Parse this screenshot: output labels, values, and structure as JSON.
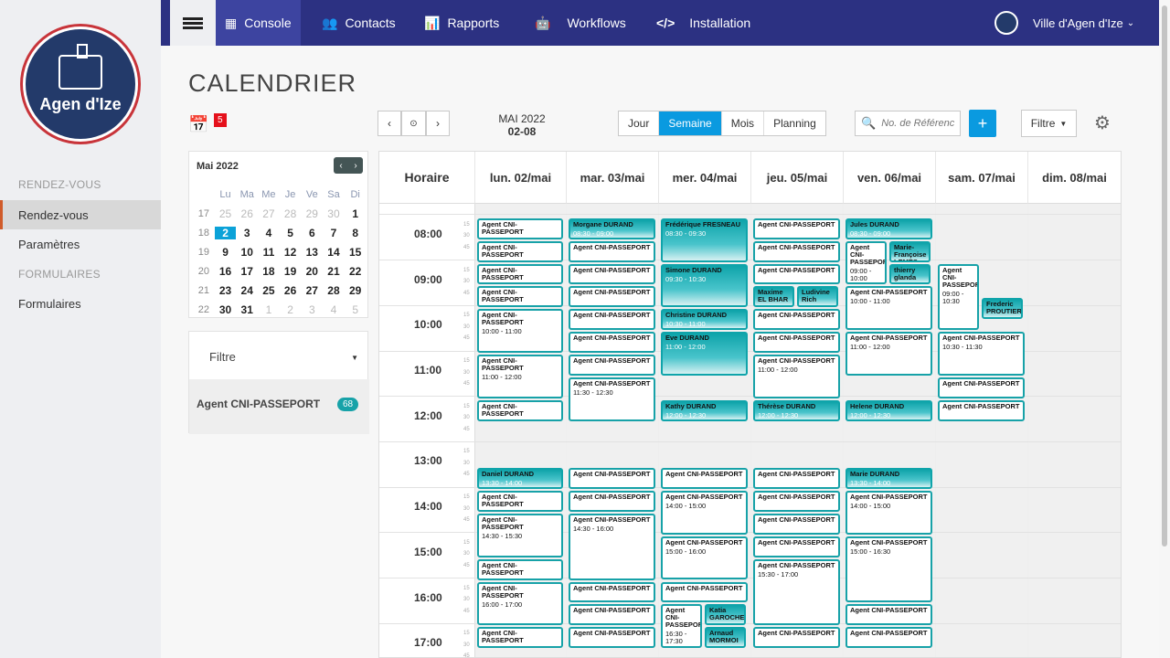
{
  "nav": {
    "items": [
      {
        "label": "Console",
        "icon": "grid-icon",
        "active": true
      },
      {
        "label": "Contacts",
        "icon": "users-icon",
        "active": false
      },
      {
        "label": "Rapports",
        "icon": "bar-chart-icon",
        "active": false
      },
      {
        "label": "Workflows",
        "icon": "robot-icon",
        "active": false
      },
      {
        "label": "Installation",
        "icon": "code-icon",
        "active": false
      }
    ],
    "org": "Ville d'Agen d'Ize"
  },
  "logo": {
    "text": "Agen d'Ize"
  },
  "sidebar": {
    "section1": "RENDEZ-VOUS",
    "items1": [
      "Rendez-vous",
      "Paramètres"
    ],
    "section2": "FORMULAIRES",
    "items2": [
      "Formulaires"
    ]
  },
  "page": {
    "title": "CALENDRIER",
    "badge": "5"
  },
  "minical": {
    "month": "Mai 2022",
    "headers": [
      "Lu",
      "Ma",
      "Me",
      "Je",
      "Ve",
      "Sa",
      "Di"
    ],
    "weeks": [
      {
        "wk": "17",
        "days": [
          "25",
          "26",
          "27",
          "28",
          "29",
          "30",
          "1"
        ],
        "dim": [
          0,
          1,
          2,
          3,
          4,
          5
        ]
      },
      {
        "wk": "18",
        "days": [
          "2",
          "3",
          "4",
          "5",
          "6",
          "7",
          "8"
        ],
        "today": 0
      },
      {
        "wk": "19",
        "days": [
          "9",
          "10",
          "11",
          "12",
          "13",
          "14",
          "15"
        ]
      },
      {
        "wk": "20",
        "days": [
          "16",
          "17",
          "18",
          "19",
          "20",
          "21",
          "22"
        ]
      },
      {
        "wk": "21",
        "days": [
          "23",
          "24",
          "25",
          "26",
          "27",
          "28",
          "29"
        ]
      },
      {
        "wk": "22",
        "days": [
          "30",
          "31",
          "1",
          "2",
          "3",
          "4",
          "5"
        ],
        "dim": [
          2,
          3,
          4,
          5,
          6
        ]
      }
    ]
  },
  "filter": {
    "label": "Filtre",
    "agent": "Agent CNI-PASSEPORT",
    "count": "68"
  },
  "toolbar": {
    "month": "MAI 2022",
    "week": "02-08",
    "views": [
      "Jour",
      "Semaine",
      "Mois",
      "Planning"
    ],
    "active_view": "Semaine",
    "search_placeholder": "No. de Référence",
    "add": "+",
    "filtre": "Filtre"
  },
  "calendar": {
    "horaire": "Horaire",
    "days": [
      "lun. 02/mai",
      "mar. 03/mai",
      "mer. 04/mai",
      "jeu. 05/mai",
      "ven. 06/mai",
      "sam. 07/mai",
      "dim. 08/mai"
    ],
    "hours": [
      "08:00",
      "09:00",
      "10:00",
      "11:00",
      "12:00",
      "13:00",
      "14:00",
      "15:00",
      "16:00",
      "17:00"
    ],
    "subticks": [
      "15",
      "30",
      "45"
    ],
    "events": [
      {
        "d": 0,
        "s": 8.0,
        "e": 8.5,
        "t": "Agent CNI-PASSEPORT",
        "tm": ""
      },
      {
        "d": 0,
        "s": 8.5,
        "e": 9.0,
        "t": "Agent CNI-PASSEPORT",
        "tm": ""
      },
      {
        "d": 0,
        "s": 9.0,
        "e": 9.5,
        "t": "Agent CNI-PASSEPORT",
        "tm": ""
      },
      {
        "d": 0,
        "s": 9.5,
        "e": 10.0,
        "t": "Agent CNI-PASSEPORT",
        "tm": ""
      },
      {
        "d": 0,
        "s": 10.0,
        "e": 11.0,
        "t": "Agent CNI-PASSEPORT",
        "tm": "10:00 - 11:00"
      },
      {
        "d": 0,
        "s": 11.0,
        "e": 12.0,
        "t": "Agent CNI-PASSEPORT",
        "tm": "11:00 - 12:00"
      },
      {
        "d": 0,
        "s": 12.0,
        "e": 12.5,
        "t": "Agent CNI-PASSEPORT",
        "tm": ""
      },
      {
        "d": 0,
        "s": 13.5,
        "e": 14.0,
        "t": "Daniel DURAND",
        "tm": "13:30 - 14:00",
        "fill": true
      },
      {
        "d": 0,
        "s": 14.0,
        "e": 14.5,
        "t": "Agent CNI-PASSEPORT",
        "tm": ""
      },
      {
        "d": 0,
        "s": 14.5,
        "e": 15.5,
        "t": "Agent CNI-PASSEPORT",
        "tm": "14:30 - 15:30"
      },
      {
        "d": 0,
        "s": 15.5,
        "e": 16.0,
        "t": "Agent CNI-PASSEPORT",
        "tm": ""
      },
      {
        "d": 0,
        "s": 16.0,
        "e": 17.0,
        "t": "Agent CNI-PASSEPORT",
        "tm": "16:00 - 17:00"
      },
      {
        "d": 0,
        "s": 17.0,
        "e": 17.5,
        "t": "Agent CNI-PASSEPORT",
        "tm": ""
      },
      {
        "d": 1,
        "s": 8.0,
        "e": 8.5,
        "t": "Morgane DURAND",
        "tm": "08:30 - 09:00",
        "fill": true
      },
      {
        "d": 1,
        "s": 8.5,
        "e": 9.0,
        "t": "Agent CNI-PASSEPORT",
        "tm": ""
      },
      {
        "d": 1,
        "s": 9.0,
        "e": 9.5,
        "t": "Agent CNI-PASSEPORT",
        "tm": ""
      },
      {
        "d": 1,
        "s": 9.5,
        "e": 10.0,
        "t": "Agent CNI-PASSEPORT",
        "tm": ""
      },
      {
        "d": 1,
        "s": 10.0,
        "e": 10.5,
        "t": "Agent CNI-PASSEPORT",
        "tm": ""
      },
      {
        "d": 1,
        "s": 10.5,
        "e": 11.0,
        "t": "Agent CNI-PASSEPORT",
        "tm": ""
      },
      {
        "d": 1,
        "s": 11.0,
        "e": 11.5,
        "t": "Agent CNI-PASSEPORT",
        "tm": ""
      },
      {
        "d": 1,
        "s": 11.5,
        "e": 12.5,
        "t": "Agent CNI-PASSEPORT",
        "tm": "11:30 - 12:30"
      },
      {
        "d": 1,
        "s": 13.5,
        "e": 14.0,
        "t": "Agent CNI-PASSEPORT",
        "tm": ""
      },
      {
        "d": 1,
        "s": 14.0,
        "e": 14.5,
        "t": "Agent CNI-PASSEPORT",
        "tm": ""
      },
      {
        "d": 1,
        "s": 14.5,
        "e": 16.0,
        "t": "Agent CNI-PASSEPORT",
        "tm": "14:30 - 16:00"
      },
      {
        "d": 1,
        "s": 16.0,
        "e": 16.5,
        "t": "Agent CNI-PASSEPORT",
        "tm": ""
      },
      {
        "d": 1,
        "s": 16.5,
        "e": 17.0,
        "t": "Agent CNI-PASSEPORT",
        "tm": ""
      },
      {
        "d": 1,
        "s": 17.0,
        "e": 17.5,
        "t": "Agent CNI-PASSEPORT",
        "tm": ""
      },
      {
        "d": 2,
        "s": 8.0,
        "e": 9.0,
        "t": "Frédérique FRESNEAU",
        "tm": "08:30 - 09:30",
        "fill": true
      },
      {
        "d": 2,
        "s": 9.0,
        "e": 10.0,
        "t": "Simone DURAND",
        "tm": "09:30 - 10:30",
        "fill": true
      },
      {
        "d": 2,
        "s": 10.0,
        "e": 10.5,
        "t": "Christine DURAND",
        "tm": "10:30 - 11:00",
        "fill": true
      },
      {
        "d": 2,
        "s": 10.5,
        "e": 11.5,
        "t": "Eve DURAND",
        "tm": "11:00 - 12:00",
        "fill": true
      },
      {
        "d": 2,
        "s": 12.0,
        "e": 12.5,
        "t": "Kathy DURAND",
        "tm": "12:00 - 12:30",
        "fill": true
      },
      {
        "d": 2,
        "s": 13.5,
        "e": 14.0,
        "t": "Agent CNI-PASSEPORT",
        "tm": ""
      },
      {
        "d": 2,
        "s": 14.0,
        "e": 15.0,
        "t": "Agent CNI-PASSEPORT",
        "tm": "14:00 - 15:00"
      },
      {
        "d": 2,
        "s": 15.0,
        "e": 16.0,
        "t": "Agent CNI-PASSEPORT",
        "tm": "15:00 - 16:00"
      },
      {
        "d": 2,
        "s": 16.0,
        "e": 16.5,
        "t": "Agent CNI-PASSEPORT",
        "tm": ""
      },
      {
        "d": 2,
        "s": 16.5,
        "e": 17.5,
        "t": "Agent CNI-PASSEPORT",
        "tm": "16:30 - 17:30",
        "half": 0
      },
      {
        "d": 2,
        "s": 16.5,
        "e": 17.0,
        "t": "Katia GAROCHE",
        "tm": "",
        "fill": true,
        "half": 1
      },
      {
        "d": 2,
        "s": 17.0,
        "e": 17.5,
        "t": "Arnaud MORMOI",
        "tm": "",
        "fill": true,
        "half": 1
      },
      {
        "d": 3,
        "s": 8.0,
        "e": 8.5,
        "t": "Agent CNI-PASSEPORT",
        "tm": ""
      },
      {
        "d": 3,
        "s": 8.5,
        "e": 9.0,
        "t": "Agent CNI-PASSEPORT",
        "tm": ""
      },
      {
        "d": 3,
        "s": 9.0,
        "e": 9.5,
        "t": "Agent CNI-PASSEPORT",
        "tm": ""
      },
      {
        "d": 3,
        "s": 9.5,
        "e": 10.0,
        "t": "Maxime EL BHAR",
        "tm": "",
        "fill": true,
        "half": 0
      },
      {
        "d": 3,
        "s": 9.5,
        "e": 10.0,
        "t": "Ludivine Rich",
        "tm": "",
        "fill": true,
        "half": 1
      },
      {
        "d": 3,
        "s": 10.0,
        "e": 10.5,
        "t": "Agent CNI-PASSEPORT",
        "tm": ""
      },
      {
        "d": 3,
        "s": 10.5,
        "e": 11.0,
        "t": "Agent CNI-PASSEPORT",
        "tm": ""
      },
      {
        "d": 3,
        "s": 11.0,
        "e": 12.0,
        "t": "Agent CNI-PASSEPORT",
        "tm": "11:00 - 12:00"
      },
      {
        "d": 3,
        "s": 12.0,
        "e": 12.5,
        "t": "Thérèse DURAND",
        "tm": "12:00 - 12:30",
        "fill": true
      },
      {
        "d": 3,
        "s": 13.5,
        "e": 14.0,
        "t": "Agent CNI-PASSEPORT",
        "tm": ""
      },
      {
        "d": 3,
        "s": 14.0,
        "e": 14.5,
        "t": "Agent CNI-PASSEPORT",
        "tm": ""
      },
      {
        "d": 3,
        "s": 14.5,
        "e": 15.0,
        "t": "Agent CNI-PASSEPORT",
        "tm": ""
      },
      {
        "d": 3,
        "s": 15.0,
        "e": 15.5,
        "t": "Agent CNI-PASSEPORT",
        "tm": ""
      },
      {
        "d": 3,
        "s": 15.5,
        "e": 17.0,
        "t": "Agent CNI-PASSEPORT",
        "tm": "15:30 - 17:00"
      },
      {
        "d": 3,
        "s": 17.0,
        "e": 17.5,
        "t": "Agent CNI-PASSEPORT",
        "tm": ""
      },
      {
        "d": 4,
        "s": 8.0,
        "e": 8.5,
        "t": "Jules DURAND",
        "tm": "08:30 - 09:00",
        "fill": true
      },
      {
        "d": 4,
        "s": 8.5,
        "e": 9.5,
        "t": "Agent CNI-PASSEPORT",
        "tm": "09:00 - 10:00",
        "half": 0
      },
      {
        "d": 4,
        "s": 8.5,
        "e": 9.0,
        "t": "Marie-Françoise LEMES",
        "tm": "",
        "fill": true,
        "half": 1
      },
      {
        "d": 4,
        "s": 9.0,
        "e": 9.5,
        "t": "thierry glanda",
        "tm": "",
        "fill": true,
        "half": 1
      },
      {
        "d": 4,
        "s": 9.5,
        "e": 10.5,
        "t": "Agent CNI-PASSEPORT",
        "tm": "10:00 - 11:00"
      },
      {
        "d": 4,
        "s": 10.5,
        "e": 11.5,
        "t": "Agent CNI-PASSEPORT",
        "tm": "11:00 - 12:00"
      },
      {
        "d": 4,
        "s": 12.0,
        "e": 12.5,
        "t": "Helene DURAND",
        "tm": "12:00 - 12:30",
        "fill": true
      },
      {
        "d": 4,
        "s": 13.5,
        "e": 14.0,
        "t": "Marie DURAND",
        "tm": "13:30 - 14:00",
        "fill": true
      },
      {
        "d": 4,
        "s": 14.0,
        "e": 15.0,
        "t": "Agent CNI-PASSEPORT",
        "tm": "14:00 - 15:00"
      },
      {
        "d": 4,
        "s": 15.0,
        "e": 16.5,
        "t": "Agent CNI-PASSEPORT",
        "tm": "15:00 - 16:30"
      },
      {
        "d": 4,
        "s": 16.5,
        "e": 17.0,
        "t": "Agent CNI-PASSEPORT",
        "tm": ""
      },
      {
        "d": 4,
        "s": 17.0,
        "e": 17.5,
        "t": "Agent CNI-PASSEPORT",
        "tm": ""
      },
      {
        "d": 5,
        "s": 9.0,
        "e": 10.5,
        "t": "Agent CNI-PASSEPORT",
        "tm": "09:00 - 10:30",
        "half": 0
      },
      {
        "d": 5,
        "s": 9.75,
        "e": 10.25,
        "t": "Frederic PROUTIER",
        "tm": "",
        "fill": true,
        "half": 1
      },
      {
        "d": 5,
        "s": 10.5,
        "e": 11.5,
        "t": "Agent CNI-PASSEPORT",
        "tm": "10:30 - 11:30"
      },
      {
        "d": 5,
        "s": 11.5,
        "e": 12.0,
        "t": "Agent CNI-PASSEPORT",
        "tm": ""
      },
      {
        "d": 5,
        "s": 12.0,
        "e": 12.5,
        "t": "Agent CNI-PASSEPORT",
        "tm": ""
      }
    ]
  },
  "colors": {
    "nav": "#2c3182",
    "accent": "#0a9ae0",
    "event": "#17a2a8",
    "badge": "#e5101b"
  }
}
